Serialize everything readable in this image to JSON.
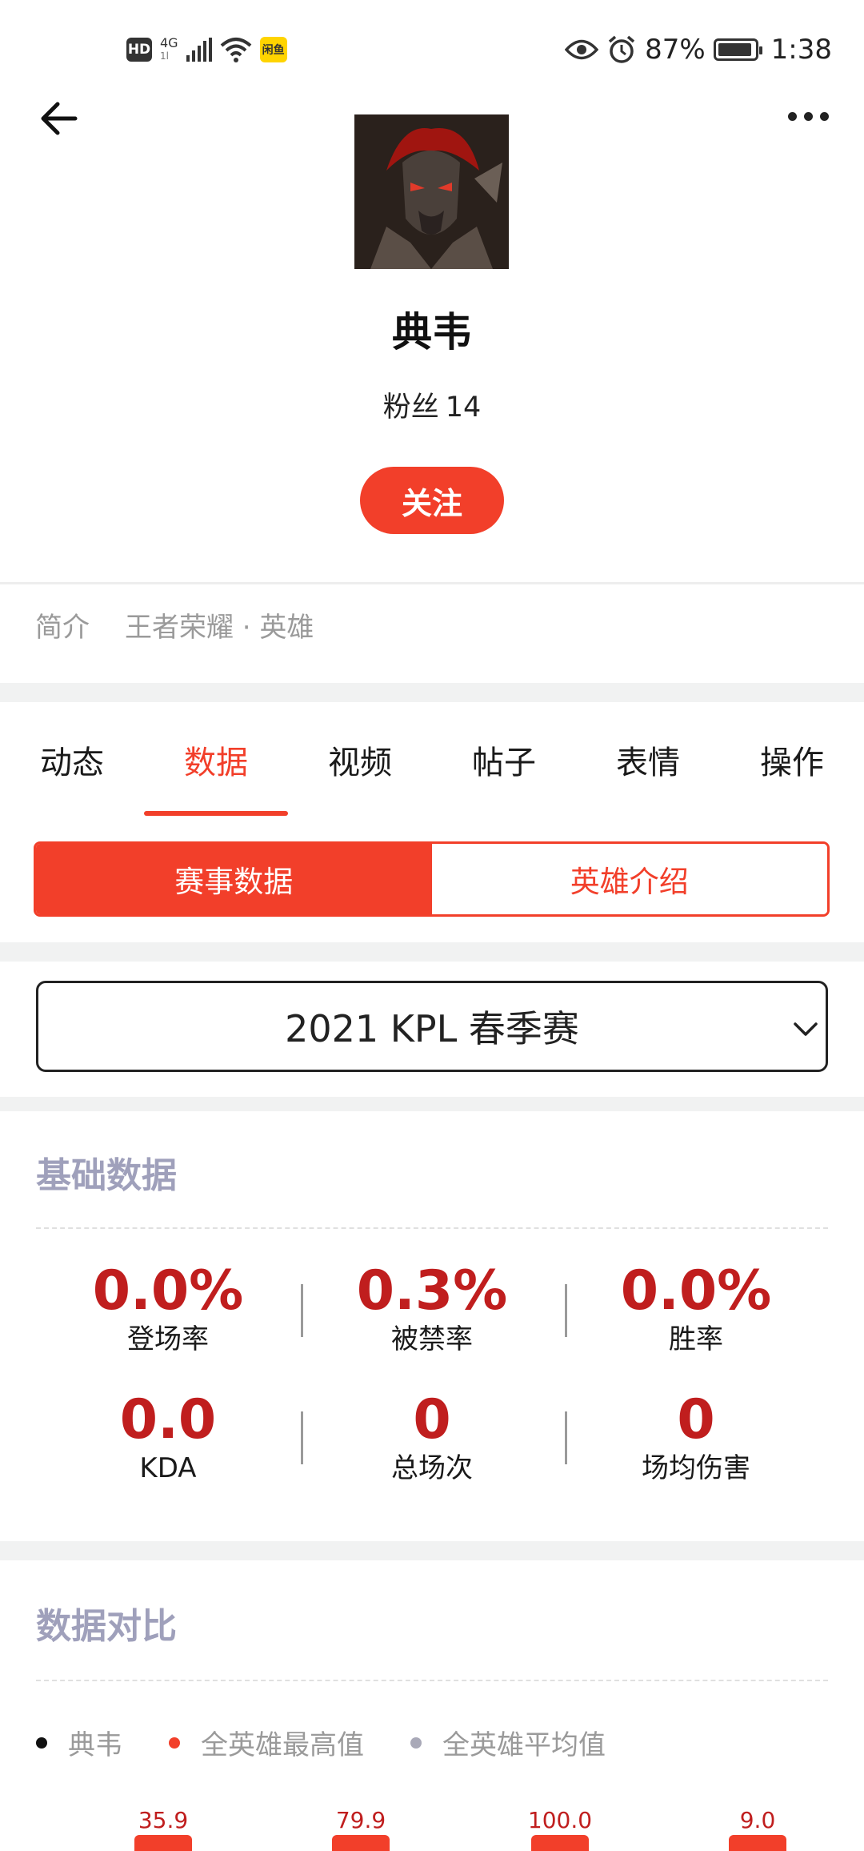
{
  "status_bar": {
    "hd": "HD",
    "network": "4G",
    "network_sub": "1l",
    "carrier_badge": "闲鱼",
    "battery": "87%",
    "time": "1:38"
  },
  "header": {
    "back_icon": "arrow-left-icon",
    "more_icon": "more-horizontal-icon"
  },
  "profile": {
    "name": "典韦",
    "fans_label": "粉丝",
    "fans_count": "14",
    "follow_label": "关注"
  },
  "intro": {
    "label": "简介",
    "text": "王者荣耀 · 英雄"
  },
  "tabs": [
    {
      "label": "动态",
      "active": false
    },
    {
      "label": "数据",
      "active": true
    },
    {
      "label": "视频",
      "active": false
    },
    {
      "label": "帖子",
      "active": false
    },
    {
      "label": "表情",
      "active": false
    },
    {
      "label": "操作",
      "active": false
    }
  ],
  "segment": {
    "left": "赛事数据",
    "right": "英雄介绍"
  },
  "season_select": {
    "value": "2021 KPL 春季赛"
  },
  "basic_data": {
    "title": "基础数据",
    "stats": [
      {
        "value": "0.0%",
        "label": "登场率"
      },
      {
        "value": "0.3%",
        "label": "被禁率"
      },
      {
        "value": "0.0%",
        "label": "胜率"
      },
      {
        "value": "0.0",
        "label": "KDA"
      },
      {
        "value": "0",
        "label": "总场次"
      },
      {
        "value": "0",
        "label": "场均伤害"
      }
    ]
  },
  "compare": {
    "title": "数据对比",
    "legend": [
      {
        "label": "典韦",
        "color": "#111111"
      },
      {
        "label": "全英雄最高值",
        "color": "#f23f2a"
      },
      {
        "label": "全英雄平均值",
        "color": "#a9a9b8"
      }
    ],
    "bar_values": [
      "35.9",
      "79.9",
      "100.0",
      "9.0"
    ]
  },
  "colors": {
    "accent": "#f23f2a",
    "stat_red": "#c01e1e",
    "section_title": "#9fa0bb"
  }
}
